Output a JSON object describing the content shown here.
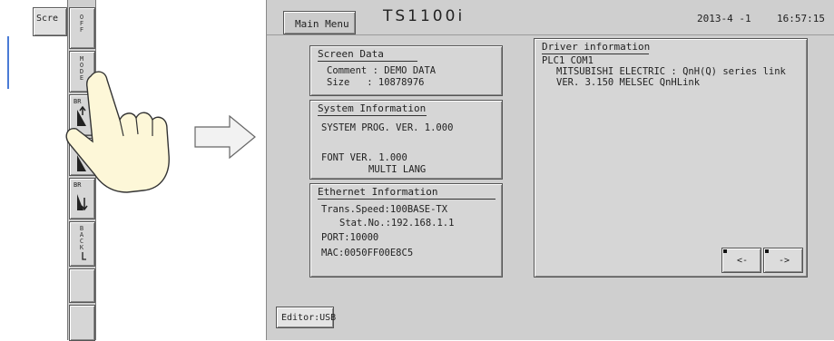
{
  "left_panel": {
    "screen_tab_label": "Scre",
    "toolbar_buttons": [
      {
        "label": "OFF"
      },
      {
        "label": "MODE"
      },
      {
        "label": "BR"
      },
      {
        "label": ""
      },
      {
        "label": "BR"
      },
      {
        "label": "BACK"
      },
      {
        "label": ""
      },
      {
        "label": ""
      }
    ]
  },
  "header": {
    "main_menu_label": "Main Menu",
    "model": "TS1100i",
    "date": "2013-4 -1",
    "time": "16:57:15"
  },
  "screen_data": {
    "title": "Screen Data",
    "comment_line": "Comment : DEMO DATA",
    "size_line": "Size   : 10878976"
  },
  "system_info": {
    "title": "System Information",
    "prog_line": "SYSTEM PROG. VER. 1.000",
    "font_line": "FONT VER. 1.000",
    "lang_line": "MULTI LANG"
  },
  "ethernet_info": {
    "title": "Ethernet Information",
    "speed_line": "Trans.Speed:100BASE-TX",
    "stat_line": "Stat.No.:192.168.1.1",
    "port_line": "PORT:10000",
    "mac_line": "MAC:0050FF00E8C5"
  },
  "driver_info": {
    "title": "Driver information",
    "line1": "PLC1 COM1",
    "line2": "MITSUBISHI ELECTRIC : QnH(Q) series link",
    "line3": "VER. 3.150 MELSEC QnHLink",
    "prev_label": "<-",
    "next_label": "->"
  },
  "footer": {
    "editor_label": "Editor:USB"
  }
}
